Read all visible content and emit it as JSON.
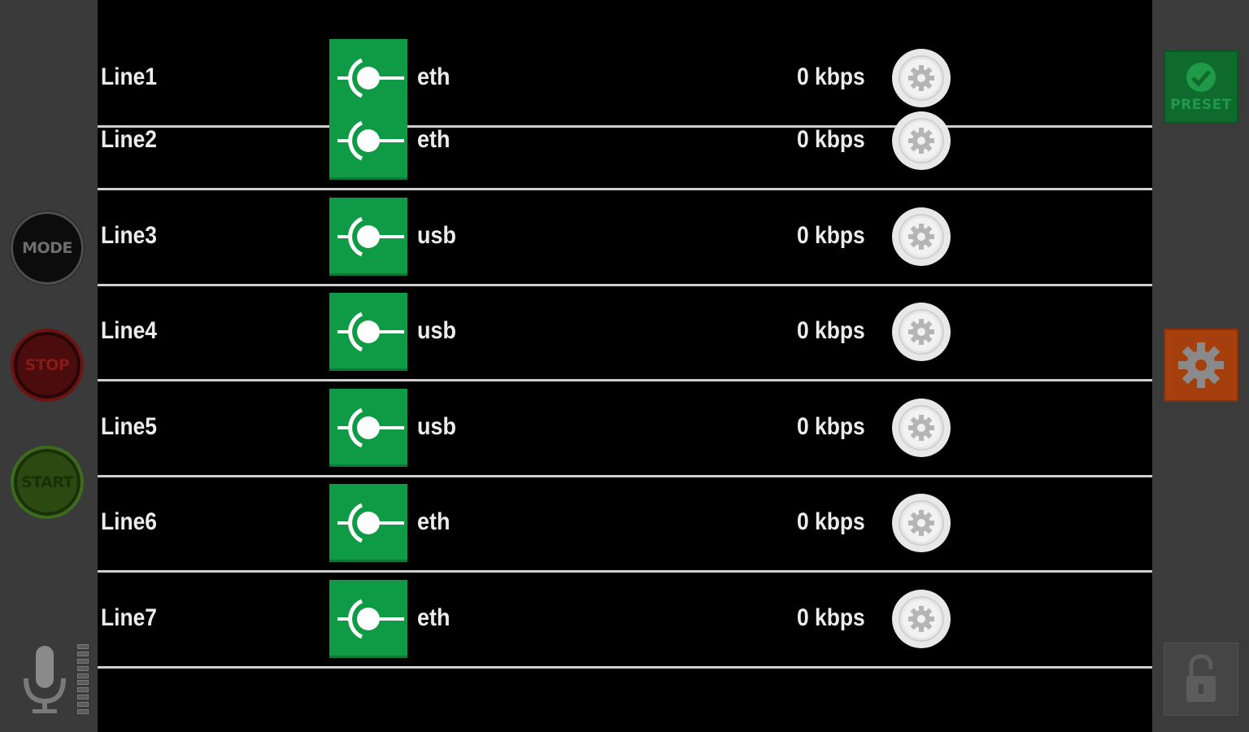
{
  "left_controls": {
    "mode_label": "MODE",
    "stop_label": "STOP",
    "start_label": "START",
    "mic_icon": "microphone-icon",
    "level_meter_icon": "level-meter-icon"
  },
  "lines": [
    {
      "name": "Line1",
      "interface": "eth",
      "rate": "0 kbps"
    },
    {
      "name": "Line2",
      "interface": "eth",
      "rate": "0 kbps"
    },
    {
      "name": "Line3",
      "interface": "usb",
      "rate": "0 kbps"
    },
    {
      "name": "Line4",
      "interface": "usb",
      "rate": "0 kbps"
    },
    {
      "name": "Line5",
      "interface": "usb",
      "rate": "0 kbps"
    },
    {
      "name": "Line6",
      "interface": "eth",
      "rate": "0 kbps"
    },
    {
      "name": "Line7",
      "interface": "eth",
      "rate": "0 kbps"
    }
  ],
  "right_controls": {
    "preset_label": "PRESET",
    "settings_icon": "gear-icon",
    "lock_icon": "unlock-icon"
  },
  "colors": {
    "connection_green": "#0f9a45",
    "preset_green": "#0f6a2e",
    "settings_orange": "#a5400e",
    "stop_red": "#4a0c0c",
    "start_green": "#2a4a12"
  }
}
